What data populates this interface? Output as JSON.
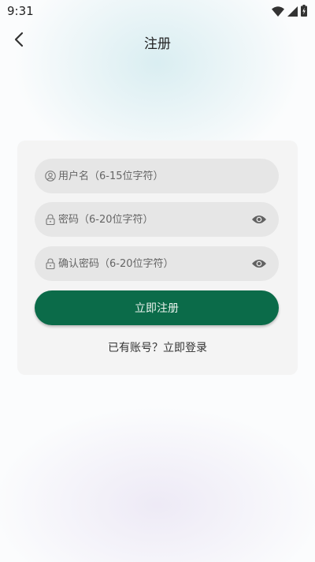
{
  "status_bar": {
    "time": "9:31",
    "icons": [
      "wifi-icon",
      "cellular-signal-icon",
      "battery-charging-icon"
    ]
  },
  "header": {
    "title": "注册",
    "back_icon": "chevron-left-icon"
  },
  "form": {
    "username": {
      "placeholder": "用户名（6-15位字符）",
      "icon": "user-circle-icon"
    },
    "password": {
      "placeholder": "密码（6-20位字符）",
      "icon": "lock-icon",
      "toggle_icon": "eye-icon"
    },
    "confirm_password": {
      "placeholder": "确认密码（6-20位字符）",
      "icon": "lock-icon",
      "toggle_icon": "eye-icon"
    },
    "submit_label": "立即注册",
    "login_link": "已有账号？立即登录"
  },
  "colors": {
    "primary": "#0b6b49",
    "field_bg": "#e6e6e6",
    "card_bg": "#f4f4f4"
  }
}
